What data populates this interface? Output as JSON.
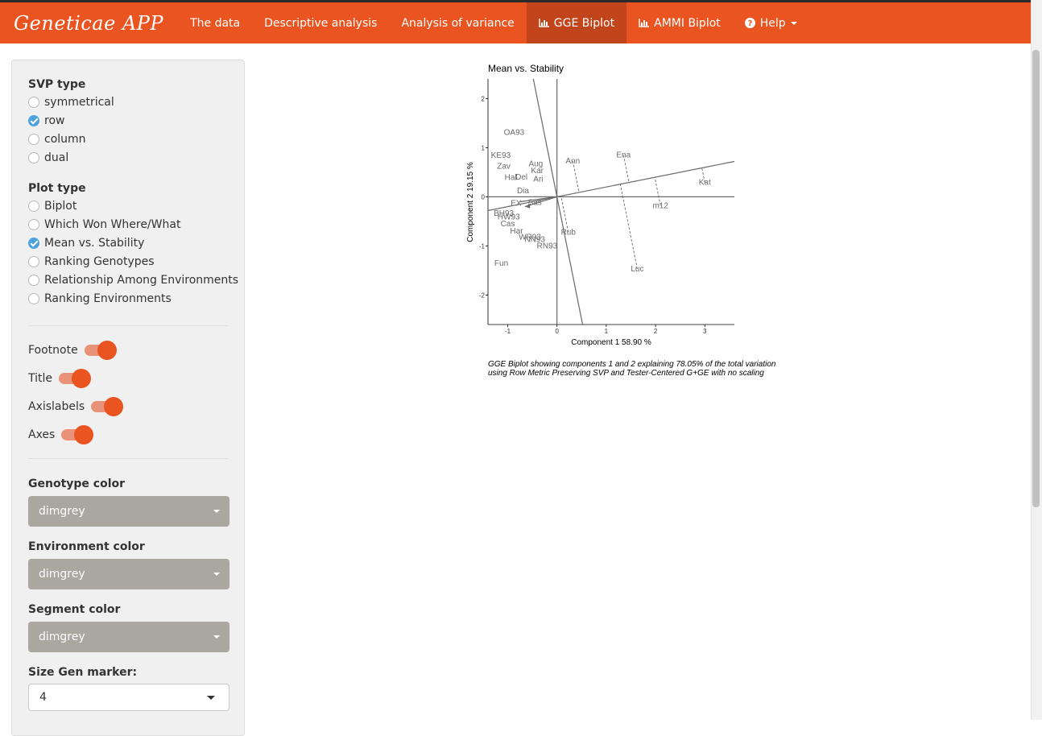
{
  "navbar": {
    "brand": "Geneticae APP",
    "items": [
      {
        "label": "The data"
      },
      {
        "label": "Descriptive analysis"
      },
      {
        "label": "Analysis of variance"
      },
      {
        "label": "GGE Biplot",
        "icon": "bar-chart-icon",
        "active": true
      },
      {
        "label": "AMMI Biplot",
        "icon": "bar-chart-icon"
      },
      {
        "label": "Help",
        "icon": "question-circle-icon",
        "dropdown": true
      }
    ]
  },
  "sidebar": {
    "svp_label": "SVP type",
    "svp_options": [
      "symmetrical",
      "row",
      "column",
      "dual"
    ],
    "svp_selected": "row",
    "plot_label": "Plot type",
    "plot_options": [
      "Biplot",
      "Which Won Where/What",
      "Mean vs. Stability",
      "Ranking Genotypes",
      "Relationship Among Environments",
      "Ranking Environments"
    ],
    "plot_selected": "Mean vs. Stability",
    "switches": [
      {
        "label": "Footnote",
        "on": true
      },
      {
        "label": "Title",
        "on": true
      },
      {
        "label": "Axislabels",
        "on": true
      },
      {
        "label": "Axes",
        "on": true
      }
    ],
    "genotype_color_label": "Genotype color",
    "genotype_color_value": "dimgrey",
    "environment_color_label": "Environment color",
    "environment_color_value": "dimgrey",
    "segment_color_label": "Segment color",
    "segment_color_value": "dimgrey",
    "size_gen_label": "Size Gen marker:",
    "size_gen_value": "4"
  },
  "colors": {
    "accent": "#ea5420",
    "accent_active": "#c1441a",
    "radio_checked": "#4aa3df",
    "select_bg": "#aaa6a0",
    "plot_color": "#696969"
  },
  "plot": {
    "title": "Mean vs. Stability",
    "xlabel": "Component 1 58.90 %",
    "ylabel": "Component 2 19.15 %",
    "caption_line1": "GGE Biplot showing components 1 and 2 explaining 78.05% of the total variation",
    "caption_line2": "using Row Metric Preserving SVP and Tester-Centered G+GE with no scaling"
  },
  "chart_data": {
    "type": "scatter",
    "title": "Mean vs. Stability",
    "xlabel": "Component 1 58.90 %",
    "ylabel": "Component 2 19.15 %",
    "xlim": [
      -1.4,
      3.6
    ],
    "ylim": [
      -2.6,
      2.4
    ],
    "xticks": [
      -1,
      0,
      1,
      2,
      3
    ],
    "yticks": [
      -2,
      -1,
      0,
      1,
      2
    ],
    "environments": [
      {
        "label": "Ann",
        "x": 0.32,
        "y": 0.73
      },
      {
        "label": "Ena",
        "x": 1.35,
        "y": 0.85
      },
      {
        "label": "Kat",
        "x": 3.0,
        "y": 0.29
      },
      {
        "label": "m12",
        "x": 2.1,
        "y": -0.18
      },
      {
        "label": "Rub",
        "x": 0.23,
        "y": -0.72
      },
      {
        "label": "Luc",
        "x": 1.63,
        "y": -1.47
      }
    ],
    "genotypes": [
      {
        "label": "OA93",
        "x": -0.87,
        "y": 1.31
      },
      {
        "label": "KE93",
        "x": -1.14,
        "y": 0.84
      },
      {
        "label": "Zav",
        "x": -1.08,
        "y": 0.62
      },
      {
        "label": "Aug",
        "x": -0.43,
        "y": 0.67
      },
      {
        "label": "Kar",
        "x": -0.4,
        "y": 0.53
      },
      {
        "label": "Ari",
        "x": -0.38,
        "y": 0.36
      },
      {
        "label": "Del",
        "x": -0.72,
        "y": 0.4
      },
      {
        "label": "Hal",
        "x": -0.94,
        "y": 0.39
      },
      {
        "label": "Dia",
        "x": -0.69,
        "y": 0.12
      },
      {
        "label": "EX",
        "x": -0.83,
        "y": -0.13
      },
      {
        "label": "Sas",
        "x": -0.45,
        "y": -0.12
      },
      {
        "label": "BH93",
        "x": -1.08,
        "y": -0.34
      },
      {
        "label": "HW93",
        "x": -0.98,
        "y": -0.41
      },
      {
        "label": "Cas",
        "x": -1.0,
        "y": -0.55
      },
      {
        "label": "Har",
        "x": -0.82,
        "y": -0.7
      },
      {
        "label": "WR93",
        "x": -0.55,
        "y": -0.82
      },
      {
        "label": "NN93",
        "x": -0.45,
        "y": -0.87
      },
      {
        "label": "RN93",
        "x": -0.2,
        "y": -1.0
      },
      {
        "label": "Fun",
        "x": -1.13,
        "y": -1.35
      }
    ],
    "ate_abscissa_slope": 0.2,
    "ate_ordinate_slope": -5.0,
    "grid": false
  }
}
